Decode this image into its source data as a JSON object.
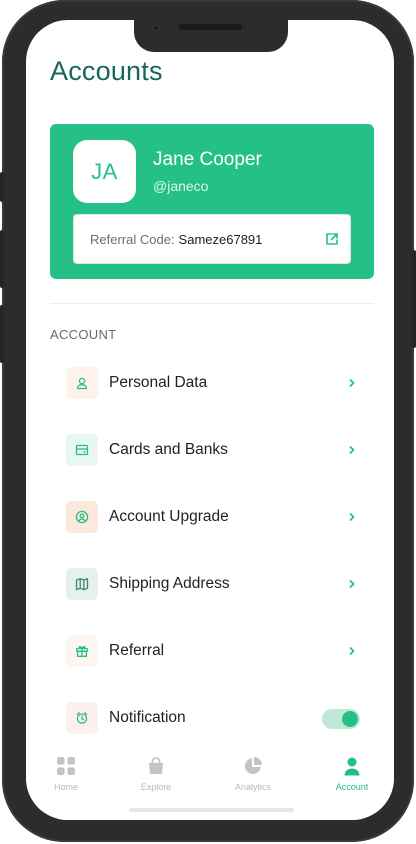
{
  "header": {
    "title": "Accounts"
  },
  "profile": {
    "initials": "JA",
    "name": "Jane Cooper",
    "handle": "@janeco",
    "referral_label": "Referral Code:",
    "referral_code": "Sameze67891"
  },
  "section_title": "ACCOUNT",
  "menu": [
    {
      "label": "Personal Data",
      "icon": "user-icon",
      "icon_bg": "#fdf3ea",
      "icon_color": "#24c085"
    },
    {
      "label": "Cards and Banks",
      "icon": "card-icon",
      "icon_bg": "#e8f7ef",
      "icon_color": "#24c085"
    },
    {
      "label": "Account Upgrade",
      "icon": "user-circle-icon",
      "icon_bg": "#fde9dc",
      "icon_color": "#24c085"
    },
    {
      "label": "Shipping Address",
      "icon": "map-icon",
      "icon_bg": "#e6f0ee",
      "icon_color": "#3a8a74"
    },
    {
      "label": "Referral",
      "icon": "gift-icon",
      "icon_bg": "#fdf6f0",
      "icon_color": "#24c085"
    },
    {
      "label": "Notification",
      "icon": "alarm-icon",
      "icon_bg": "#fdf0ee",
      "icon_color": "#24c085",
      "toggle": true
    }
  ],
  "nav": [
    {
      "label": "Home",
      "icon": "grid-icon"
    },
    {
      "label": "Explore",
      "icon": "bag-icon"
    },
    {
      "label": "Analytics",
      "icon": "pie-chart-icon"
    },
    {
      "label": "Account",
      "icon": "person-icon",
      "active": true
    }
  ],
  "colors": {
    "accent": "#24c085",
    "title": "#16665a",
    "inactive": "#c4c4c4"
  }
}
